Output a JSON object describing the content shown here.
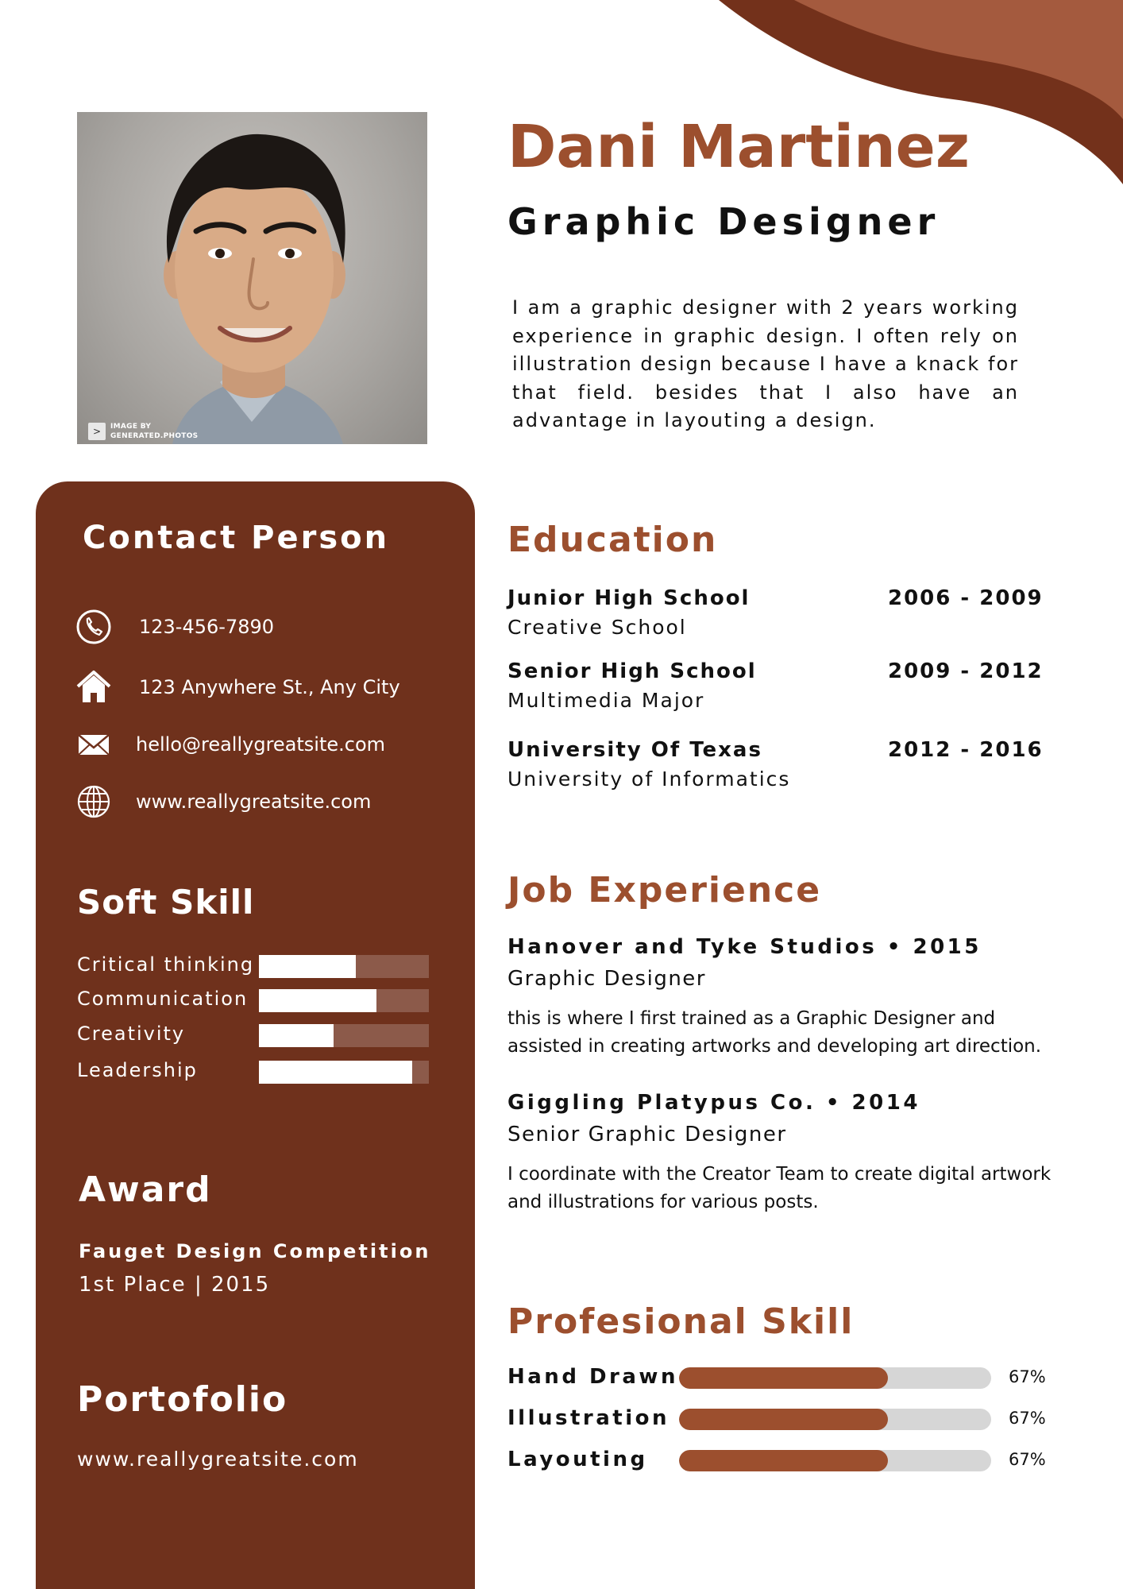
{
  "colors": {
    "accent": "#9c4f2e",
    "sidebar": "#6f311c",
    "decor_dark": "#73311b",
    "decor_light": "#a45a3e"
  },
  "profile": {
    "name": "Dani Martinez",
    "title": "Graphic Designer",
    "summary": "I am a graphic designer with 2 years working experience in graphic design. I often rely on illustration design because I have a knack for that field. besides that I also have an advantage in layouting a design.",
    "photo_watermark": "IMAGE BY\nGENERATED.PHOTOS"
  },
  "contact": {
    "title": "Contact Person",
    "items": [
      {
        "icon": "phone-icon",
        "text": "123-456-7890"
      },
      {
        "icon": "home-icon",
        "text": "123 Anywhere St., Any City"
      },
      {
        "icon": "mail-icon",
        "text": "hello@reallygreatsite.com"
      },
      {
        "icon": "globe-icon",
        "text": "www.reallygreatsite.com"
      }
    ]
  },
  "soft_skill": {
    "title": "Soft Skill",
    "items": [
      {
        "label": "Critical thinking",
        "level": 0.57
      },
      {
        "label": "Communication",
        "level": 0.69
      },
      {
        "label": "Creativity",
        "level": 0.44
      },
      {
        "label": "Leadership",
        "level": 0.9
      }
    ]
  },
  "award": {
    "title": "Award",
    "name": "Fauget Design Competition",
    "detail": "1st Place | 2015"
  },
  "portfolio": {
    "title": "Portofolio",
    "url": "www.reallygreatsite.com"
  },
  "education": {
    "title": "Education",
    "items": [
      {
        "school": "Junior High School",
        "years": "2006 - 2009",
        "sub": "Creative School"
      },
      {
        "school": "Senior High School",
        "years": "2009 - 2012",
        "sub": "Multimedia Major"
      },
      {
        "school": "University Of Texas",
        "years": "2012 - 2016",
        "sub": "University of Informatics"
      }
    ]
  },
  "job_experience": {
    "title": "Job Experience",
    "items": [
      {
        "head": " Hanover and Tyke Studios • 2015",
        "position": "Graphic Designer",
        "description": " this is where I first trained as a Graphic Designer and assisted in creating artworks and developing art direction."
      },
      {
        "head": "Giggling Platypus Co.  • 2014",
        "position": "Senior Graphic Designer",
        "description": "I coordinate with the Creator Team to create digital artwork and illustrations for various posts."
      }
    ]
  },
  "professional_skill": {
    "title": "Profesional Skill",
    "items": [
      {
        "label": "Hand Drawn",
        "percent": 67,
        "percent_label": "67%"
      },
      {
        "label": "Illustration",
        "percent": 67,
        "percent_label": "67%"
      },
      {
        "label": "Layouting",
        "percent": 67,
        "percent_label": "67%"
      }
    ]
  }
}
